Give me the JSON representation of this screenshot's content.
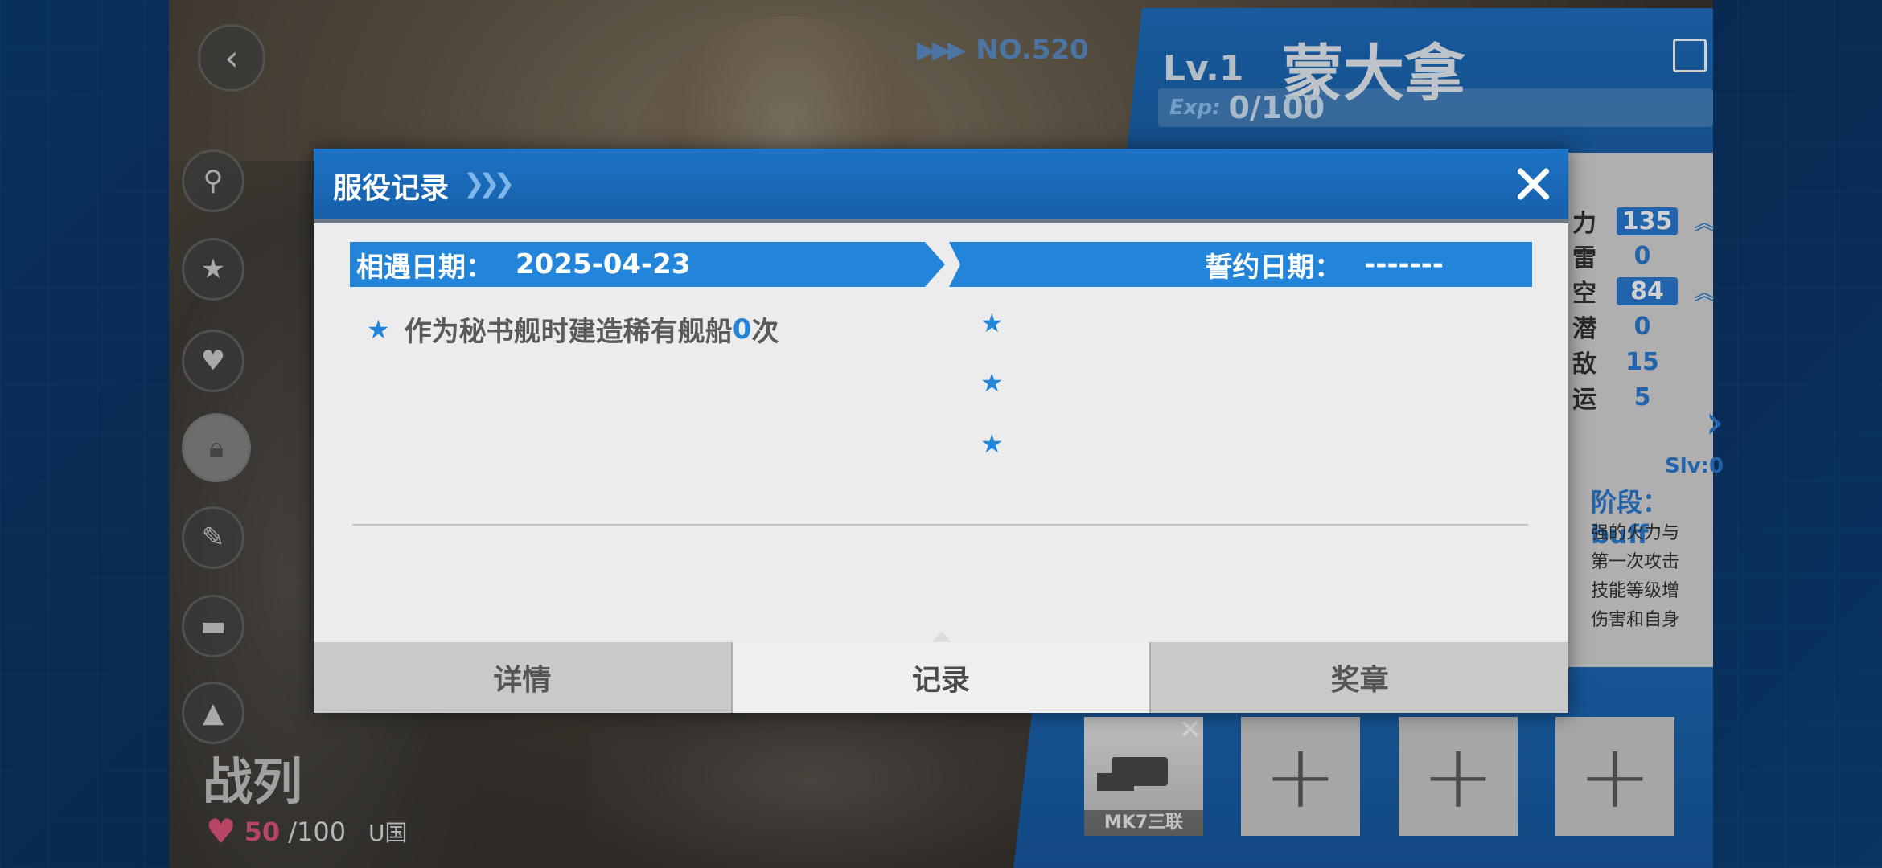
{
  "background": {
    "ship_type": "战列",
    "hp_current": "50",
    "hp_max": "/100",
    "nation": "U国",
    "number_label": "NO.520"
  },
  "ship_panel": {
    "level": "Lv.1",
    "name": "蒙大拿",
    "exp_label": "Exp:",
    "exp_value": "0/100",
    "stats": [
      {
        "name": "力",
        "value": "135",
        "boxed": true,
        "upgradeable": true
      },
      {
        "name": "雷",
        "value": "0",
        "boxed": false,
        "upgradeable": false
      },
      {
        "name": "空",
        "value": "84",
        "boxed": true,
        "upgradeable": true
      },
      {
        "name": "潜",
        "value": "0",
        "boxed": false,
        "upgradeable": false
      },
      {
        "name": "敌",
        "value": "15",
        "boxed": false,
        "upgradeable": false
      },
      {
        "name": "运",
        "value": "5",
        "boxed": false,
        "upgradeable": false
      }
    ],
    "slv": "Slv:0",
    "skill_stage": "阶段：  buff",
    "skill_desc_lines": [
      "强的火力与",
      "第一次攻击",
      "技能等级增",
      "伤害和自身"
    ]
  },
  "equipment": {
    "slot1_name": "MK7三联",
    "slot1_close": "✕",
    "empty_plus": "+"
  },
  "dialog": {
    "title": "服役记录",
    "meet_label": "相遇日期：",
    "meet_date": "2025-04-23",
    "oath_label": "誓约日期：",
    "oath_date": "-------",
    "record_prefix": "作为秘书舰时建造稀有舰船",
    "record_count": "0",
    "record_suffix": "次",
    "star_icon": "★",
    "tabs": [
      {
        "label": "详情",
        "active": false
      },
      {
        "label": "记录",
        "active": true
      },
      {
        "label": "奖章",
        "active": false
      }
    ]
  },
  "colors": {
    "accent_blue": "#2385d9",
    "header_blue": "#1d73c6",
    "hp_pink": "#e0557a"
  }
}
